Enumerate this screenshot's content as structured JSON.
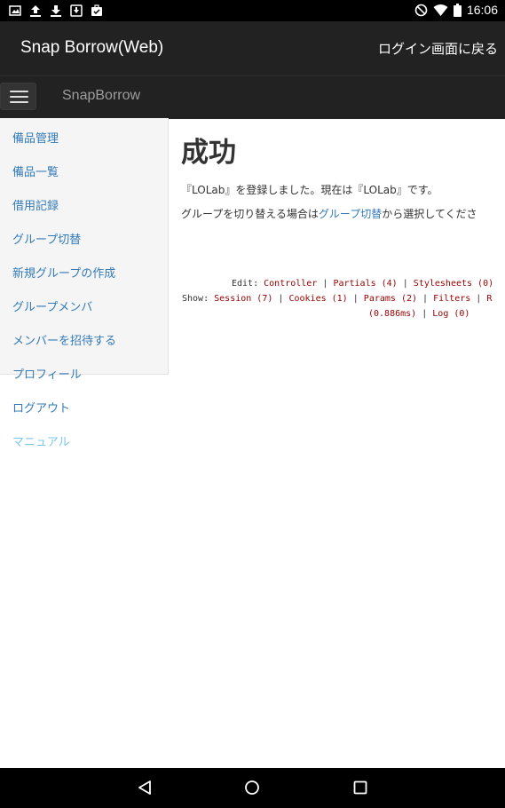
{
  "status_bar": {
    "time": "16:06",
    "left_icons": [
      "image-icon",
      "upload-icon",
      "download-icon",
      "download-box-icon",
      "briefcase-check-icon"
    ],
    "right_icons": [
      "do-not-disturb-icon",
      "wifi-icon",
      "battery-icon"
    ]
  },
  "app_bar": {
    "title": "Snap Borrow(Web)",
    "back_label": "ログイン画面に戻る"
  },
  "navbar": {
    "brand": "SnapBorrow"
  },
  "sidebar": {
    "items": [
      {
        "label": "備品管理"
      },
      {
        "label": "備品一覧"
      },
      {
        "label": "借用記録"
      },
      {
        "label": "グループ切替"
      },
      {
        "label": "新規グループの作成"
      },
      {
        "label": "グループメンバ"
      },
      {
        "label": "メンバーを招待する"
      },
      {
        "label": "プロフィール"
      },
      {
        "label": "ログアウト"
      },
      {
        "label": "マニュアル"
      }
    ]
  },
  "main": {
    "heading": "成功",
    "message": "『LOLab』を登録しました。現在は『LOLab』です。",
    "switch_prefix": "グループを切り替える場合は",
    "switch_link": "グループ切替",
    "switch_suffix": "から選択してくださ"
  },
  "debug": {
    "edit_label": "Edit:",
    "controller": "Controller",
    "partials": "Partials (4)",
    "stylesheets": "Stylesheets (0)",
    "show_label": "Show:",
    "session": "Session (7)",
    "cookies": "Cookies (1)",
    "params": "Params (2)",
    "filters": "Filters",
    "r_link": "R",
    "timing": "(0.886ms)",
    "log": "Log (0)",
    "sep": "|"
  }
}
